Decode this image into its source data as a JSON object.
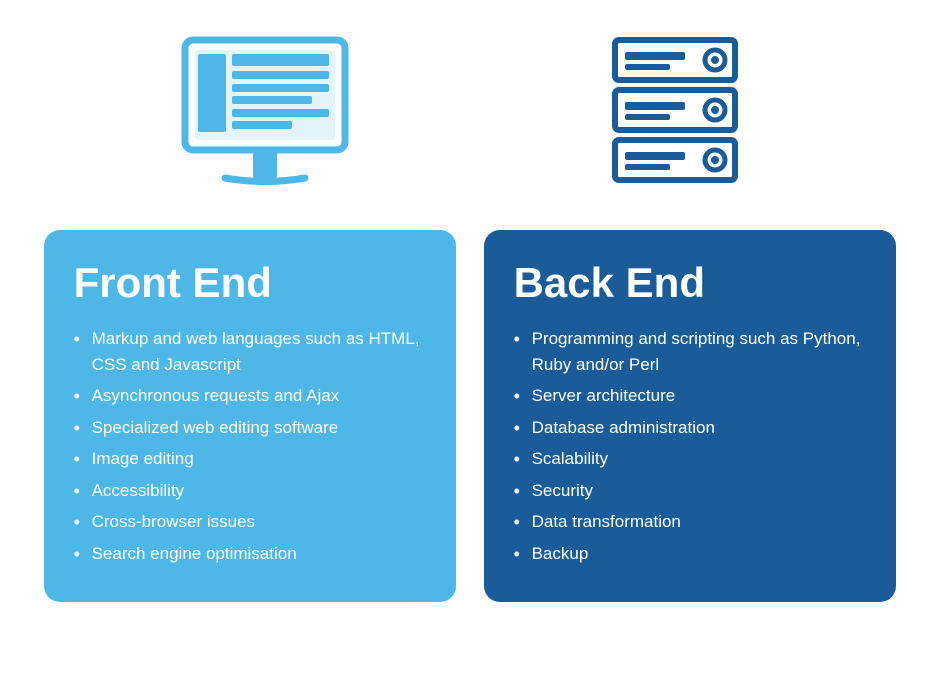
{
  "icons": {
    "monitor_label": "Monitor icon representing front end",
    "server_label": "Server rack icon representing back end"
  },
  "frontend": {
    "title": "Front End",
    "items": [
      "Markup and web languages such as HTML, CSS and Javascript",
      "Asynchronous requests and Ajax",
      "Specialized web editing software",
      "Image editing",
      "Accessibility",
      "Cross-browser issues",
      "Search engine optimisation"
    ]
  },
  "backend": {
    "title": "Back End",
    "items": [
      "Programming and scripting such as Python, Ruby and/or Perl",
      "Server architecture",
      "Database administration",
      "Scalability",
      "Security",
      "Data transformation",
      "Backup"
    ]
  }
}
